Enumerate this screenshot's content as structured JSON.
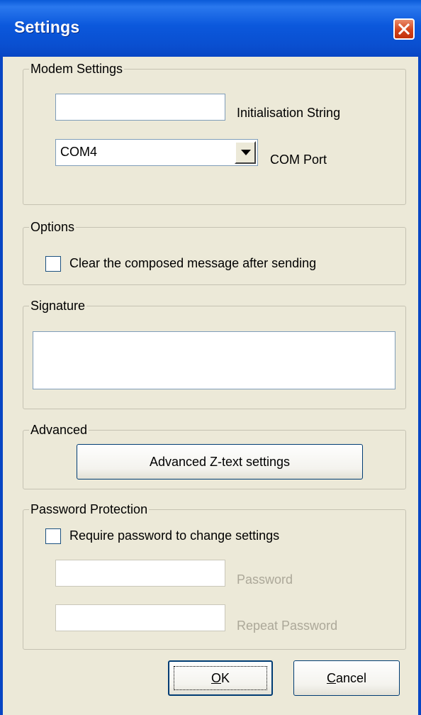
{
  "window": {
    "title": "Settings"
  },
  "modem": {
    "group_label": "Modem Settings",
    "init_string_value": "",
    "init_string_label": "Initialisation String",
    "com_port_value": "COM4",
    "com_port_label": "COM Port"
  },
  "options": {
    "group_label": "Options",
    "clear_message_label": "Clear the composed message after sending",
    "clear_message_checked": false
  },
  "signature": {
    "group_label": "Signature",
    "value": ""
  },
  "advanced": {
    "group_label": "Advanced",
    "button_label": "Advanced Z-text settings"
  },
  "password": {
    "group_label": "Password Protection",
    "require_label": "Require password to change settings",
    "require_checked": false,
    "password_label": "Password",
    "repeat_label": "Repeat Password",
    "password_value": "",
    "repeat_value": ""
  },
  "buttons": {
    "ok_mnemonic": "O",
    "ok_rest": "K",
    "cancel_mnemonic": "C",
    "cancel_rest": "ancel"
  },
  "colors": {
    "titlebar": "#0a4fd0",
    "dialog_bg": "#ece9d8",
    "close_button": "#d3441c",
    "disabled_text": "#aca899"
  }
}
